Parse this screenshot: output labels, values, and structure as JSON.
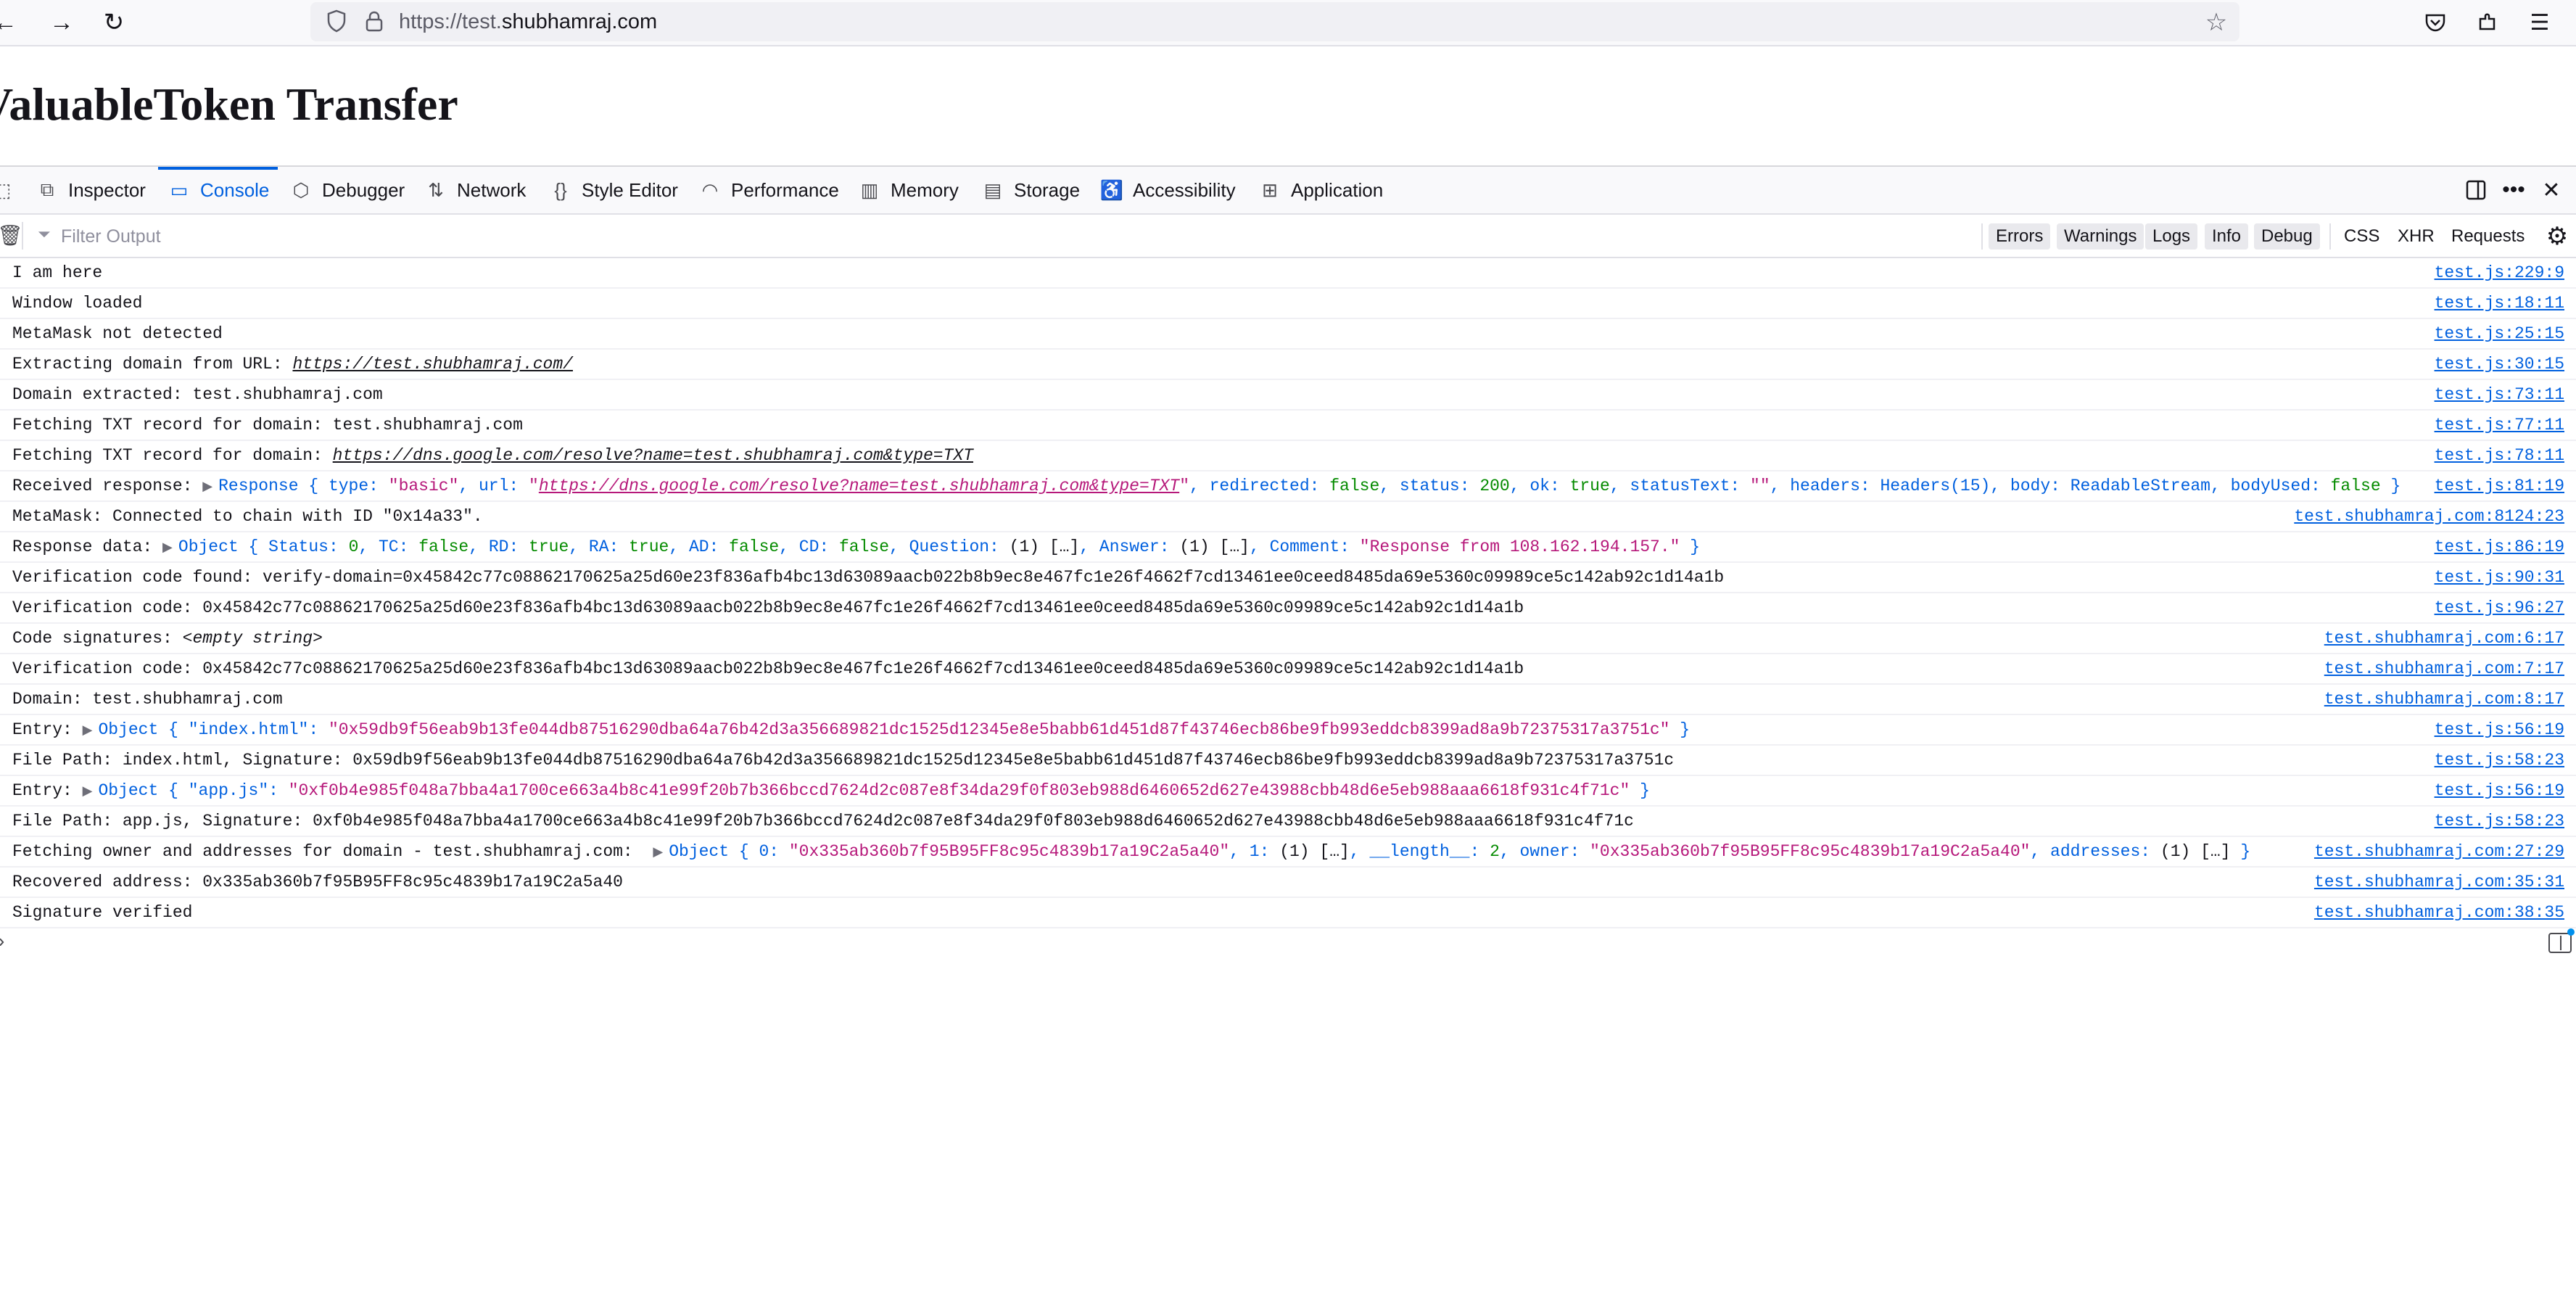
{
  "browser": {
    "url_prefix": "https://test.",
    "url_domain": "shubhamraj.com",
    "icons": {
      "back": "back-arrow-icon",
      "forward": "forward-arrow-icon",
      "reload": "reload-icon",
      "shield": "shield-icon",
      "lock": "lock-icon",
      "bookmark": "star-icon",
      "pocket": "pocket-icon",
      "extensions": "extensions-icon",
      "menu": "hamburger-menu-icon"
    }
  },
  "page": {
    "title": "ValuableToken Transfer"
  },
  "devtools": {
    "tabs": [
      {
        "label": "Inspector",
        "icon": "inspector-icon"
      },
      {
        "label": "Console",
        "icon": "console-icon",
        "selected": true
      },
      {
        "label": "Debugger",
        "icon": "debugger-icon"
      },
      {
        "label": "Network",
        "icon": "network-icon"
      },
      {
        "label": "Style Editor",
        "icon": "style-editor-icon"
      },
      {
        "label": "Performance",
        "icon": "performance-icon"
      },
      {
        "label": "Memory",
        "icon": "memory-icon"
      },
      {
        "label": "Storage",
        "icon": "storage-icon"
      },
      {
        "label": "Accessibility",
        "icon": "accessibility-icon"
      },
      {
        "label": "Application",
        "icon": "application-icon"
      }
    ],
    "filter": {
      "placeholder": "Filter Output",
      "levels": [
        "Errors",
        "Warnings",
        "Logs",
        "Info",
        "Debug"
      ],
      "extras": [
        "CSS",
        "XHR",
        "Requests"
      ]
    },
    "messages": [
      {
        "text": "I am here",
        "loc": "test.js:229:9"
      },
      {
        "text": "Window loaded",
        "loc": "test.js:18:11"
      },
      {
        "text": "MetaMask not detected",
        "loc": "test.js:25:15"
      },
      {
        "prefix": "Extracting domain from URL: ",
        "link": "https://test.shubhamraj.com/",
        "loc": "test.js:30:15"
      },
      {
        "text": "Domain extracted: test.shubhamraj.com",
        "loc": "test.js:73:11"
      },
      {
        "text": "Fetching TXT record for domain: test.shubhamraj.com",
        "loc": "test.js:77:11"
      },
      {
        "prefix": "Fetching TXT record for domain: ",
        "link": "https://dns.google.com/resolve?name=test.shubhamraj.com&type=TXT",
        "loc": "test.js:78:11"
      },
      {
        "prefix": "Received response: ",
        "response": {
          "cls": "Response",
          "type_key": "type",
          "type_val": "\"basic\"",
          "url_key": "url",
          "url_val": "https://dns.google.com/resolve?name=test.shubhamraj.com&type=TXT",
          "redirected_key": "redirected",
          "redirected_val": "false",
          "status_key": "status",
          "status_val": "200",
          "ok_key": "ok",
          "ok_val": "true",
          "statusText_key": "statusText",
          "statusText_val": "\"\"",
          "headers_key": "headers",
          "headers_val": "Headers(15)",
          "body_key": "body",
          "body_val": "ReadableStream",
          "bodyUsed_key": "bodyUsed",
          "bodyUsed_val": "false"
        },
        "loc": "test.js:81:19"
      },
      {
        "text": "MetaMask: Connected to chain with ID \"0x14a33\".",
        "loc": "test.shubhamraj.com:8124:23"
      },
      {
        "prefix": "Response data: ",
        "data": {
          "cls": "Object",
          "Status": "0",
          "TC": "false",
          "RD": "true",
          "RA": "true",
          "AD": "false",
          "CD": "false",
          "Question": "(1) […]",
          "Answer": "(1) […]",
          "Comment": "\"Response from 108.162.194.157.\""
        },
        "loc": "test.js:86:19"
      },
      {
        "text": "Verification code found: verify-domain=0x45842c77c08862170625a25d60e23f836afb4bc13d63089aacb022b8b9ec8e467fc1e26f4662f7cd13461ee0ceed8485da69e5360c09989ce5c142ab92c1d14a1b",
        "loc": "test.js:90:31"
      },
      {
        "text": "Verification code: 0x45842c77c08862170625a25d60e23f836afb4bc13d63089aacb022b8b9ec8e467fc1e26f4662f7cd13461ee0ceed8485da69e5360c09989ce5c142ab92c1d14a1b",
        "loc": "test.js:96:27"
      },
      {
        "prefix": "Code signatures: ",
        "empty": "<empty string>",
        "loc": "test.shubhamraj.com:6:17"
      },
      {
        "text": "Verification code: 0x45842c77c08862170625a25d60e23f836afb4bc13d63089aacb022b8b9ec8e467fc1e26f4662f7cd13461ee0ceed8485da69e5360c09989ce5c142ab92c1d14a1b",
        "loc": "test.shubhamraj.com:7:17"
      },
      {
        "text": "Domain: test.shubhamraj.com",
        "loc": "test.shubhamraj.com:8:17"
      },
      {
        "prefix": "Entry: ",
        "entry": {
          "cls": "Object",
          "key": "\"index.html\"",
          "val": "\"0x59db9f56eab9b13fe044db87516290dba64a76b42d3a356689821dc1525d12345e8e5babb61d451d87f43746ecb86be9fb993eddcb8399ad8a9b72375317a3751c\""
        },
        "loc": "test.js:56:19"
      },
      {
        "text": "File Path: index.html, Signature: 0x59db9f56eab9b13fe044db87516290dba64a76b42d3a356689821dc1525d12345e8e5babb61d451d87f43746ecb86be9fb993eddcb8399ad8a9b72375317a3751c",
        "loc": "test.js:58:23"
      },
      {
        "prefix": "Entry: ",
        "entry": {
          "cls": "Object",
          "key": "\"app.js\"",
          "val": "\"0xf0b4e985f048a7bba4a1700ce663a4b8c41e99f20b7b366bccd7624d2c087e8f34da29f0f803eb988d6460652d627e43988cbb48d6e5eb988aaa6618f931c4f71c\""
        },
        "loc": "test.js:56:19"
      },
      {
        "text": "File Path: app.js, Signature: 0xf0b4e985f048a7bba4a1700ce663a4b8c41e99f20b7b366bccd7624d2c087e8f34da29f0f803eb988d6460652d627e43988cbb48d6e5eb988aaa6618f931c4f71c",
        "loc": "test.js:58:23"
      },
      {
        "prefix": "Fetching owner and addresses for domain - test.shubhamraj.com:  ",
        "owner": {
          "cls": "Object",
          "k0": "0",
          "v0": "\"0x335ab360b7f95B95FF8c95c4839b17a19C2a5a40\"",
          "k1": "1",
          "v1": "(1) […]",
          "klen": "__length__",
          "vlen": "2",
          "kowner": "owner",
          "vowner": "\"0x335ab360b7f95B95FF8c95c4839b17a19C2a5a40\"",
          "kaddr": "addresses",
          "vaddr": "(1) […]"
        },
        "loc": "test.shubhamraj.com:27:29"
      },
      {
        "text": "Recovered address: 0x335ab360b7f95B95FF8c95c4839b17a19C2a5a40",
        "loc": "test.shubhamraj.com:35:31"
      },
      {
        "text": "Signature verified",
        "loc": "test.shubhamraj.com:38:35"
      }
    ]
  }
}
